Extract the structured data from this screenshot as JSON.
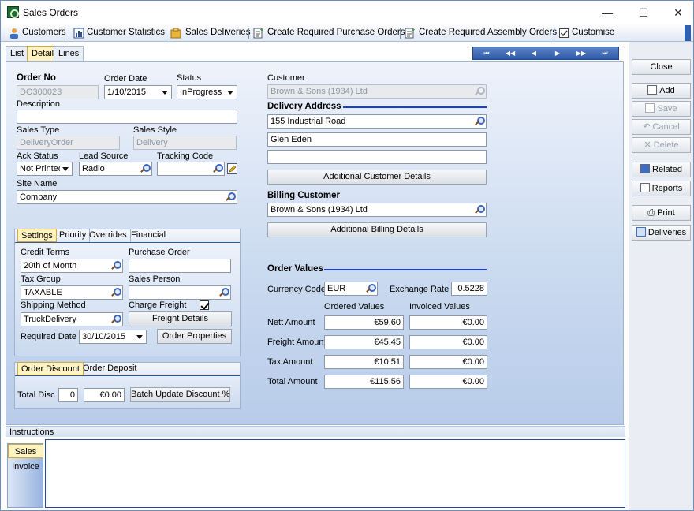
{
  "window": {
    "title": "Sales Orders",
    "minimize": "—",
    "maximize": "☐",
    "close": "✕"
  },
  "toolbar": {
    "customers": "Customers",
    "customer_statistics": "Customer Statistics",
    "sales_deliveries": "Sales Deliveries",
    "create_purchase_orders": "Create Required Purchase Orders",
    "create_assembly_orders": "Create Required Assembly Orders",
    "customise": "Customise"
  },
  "tabs": {
    "list": "List",
    "detail": "Detail",
    "lines": "Lines"
  },
  "nav": {
    "first": "⏮",
    "prev_page": "◀◀",
    "prev": "◀",
    "next": "▶",
    "next_page": "▶▶",
    "last": "⏭"
  },
  "order": {
    "order_no_label": "Order No",
    "order_no": "DO300023",
    "order_date_label": "Order Date",
    "order_date": "1/10/2015",
    "status_label": "Status",
    "status": "InProgress",
    "description_label": "Description",
    "description": "",
    "sales_type_label": "Sales Type",
    "sales_type": "DeliveryOrder",
    "sales_style_label": "Sales Style",
    "sales_style": "Delivery",
    "ack_status_label": "Ack Status",
    "ack_status": "Not Printed",
    "lead_source_label": "Lead Source",
    "lead_source": "Radio",
    "tracking_code_label": "Tracking Code",
    "tracking_code": "",
    "site_name_label": "Site Name",
    "site_name": "Company"
  },
  "settings": {
    "tabs": [
      "Settings",
      "Priority",
      "Overrides",
      "Financial"
    ],
    "credit_terms_label": "Credit Terms",
    "credit_terms": "20th of Month",
    "purchase_order_label": "Purchase Order",
    "purchase_order": "",
    "tax_group_label": "Tax Group",
    "tax_group": "TAXABLE",
    "sales_person_label": "Sales Person",
    "sales_person": "",
    "shipping_method_label": "Shipping Method",
    "shipping_method": "TruckDelivery",
    "charge_freight_label": "Charge Freight",
    "freight_details": "Freight Details",
    "required_date_label": "Required Date",
    "required_date": "30/10/2015",
    "order_properties": "Order Properties"
  },
  "discount": {
    "tabs": [
      "Order Discount",
      "Order Deposit"
    ],
    "total_disc_label": "Total Disc",
    "total_disc_pct": "0",
    "total_disc_amt": "€0.00",
    "batch_update": "Batch Update Discount %"
  },
  "customer": {
    "label": "Customer",
    "value": "Brown & Sons (1934) Ltd",
    "delivery_heading": "Delivery Address",
    "address1": "155 Industrial Road",
    "address2": "Glen Eden",
    "address3": "",
    "additional_details": "Additional Customer Details",
    "billing_heading": "Billing Customer",
    "billing": "Brown & Sons (1934) Ltd",
    "additional_billing": "Additional Billing Details"
  },
  "values": {
    "heading": "Order Values",
    "currency_label": "Currency Code",
    "currency": "EUR",
    "exchange_label": "Exchange Rate",
    "exchange": "0.5228",
    "ordered_header": "Ordered Values",
    "invoiced_header": "Invoiced Values",
    "rows": [
      {
        "label": "Nett Amount",
        "ordered": "€59.60",
        "invoiced": "€0.00"
      },
      {
        "label": "Freight Amount",
        "ordered": "€45.45",
        "invoiced": "€0.00"
      },
      {
        "label": "Tax Amount",
        "ordered": "€10.51",
        "invoiced": "€0.00"
      },
      {
        "label": "Total Amount",
        "ordered": "€115.56",
        "invoiced": "€0.00"
      }
    ]
  },
  "side": {
    "close": "Close",
    "add": "Add",
    "save": "Save",
    "cancel": "Cancel",
    "delete": "Delete",
    "related": "Related",
    "reports": "Reports",
    "print": "Print",
    "deliveries": "Deliveries"
  },
  "instructions": {
    "label": "Instructions",
    "tabs": [
      "Sales",
      "Invoice"
    ],
    "text": ""
  }
}
